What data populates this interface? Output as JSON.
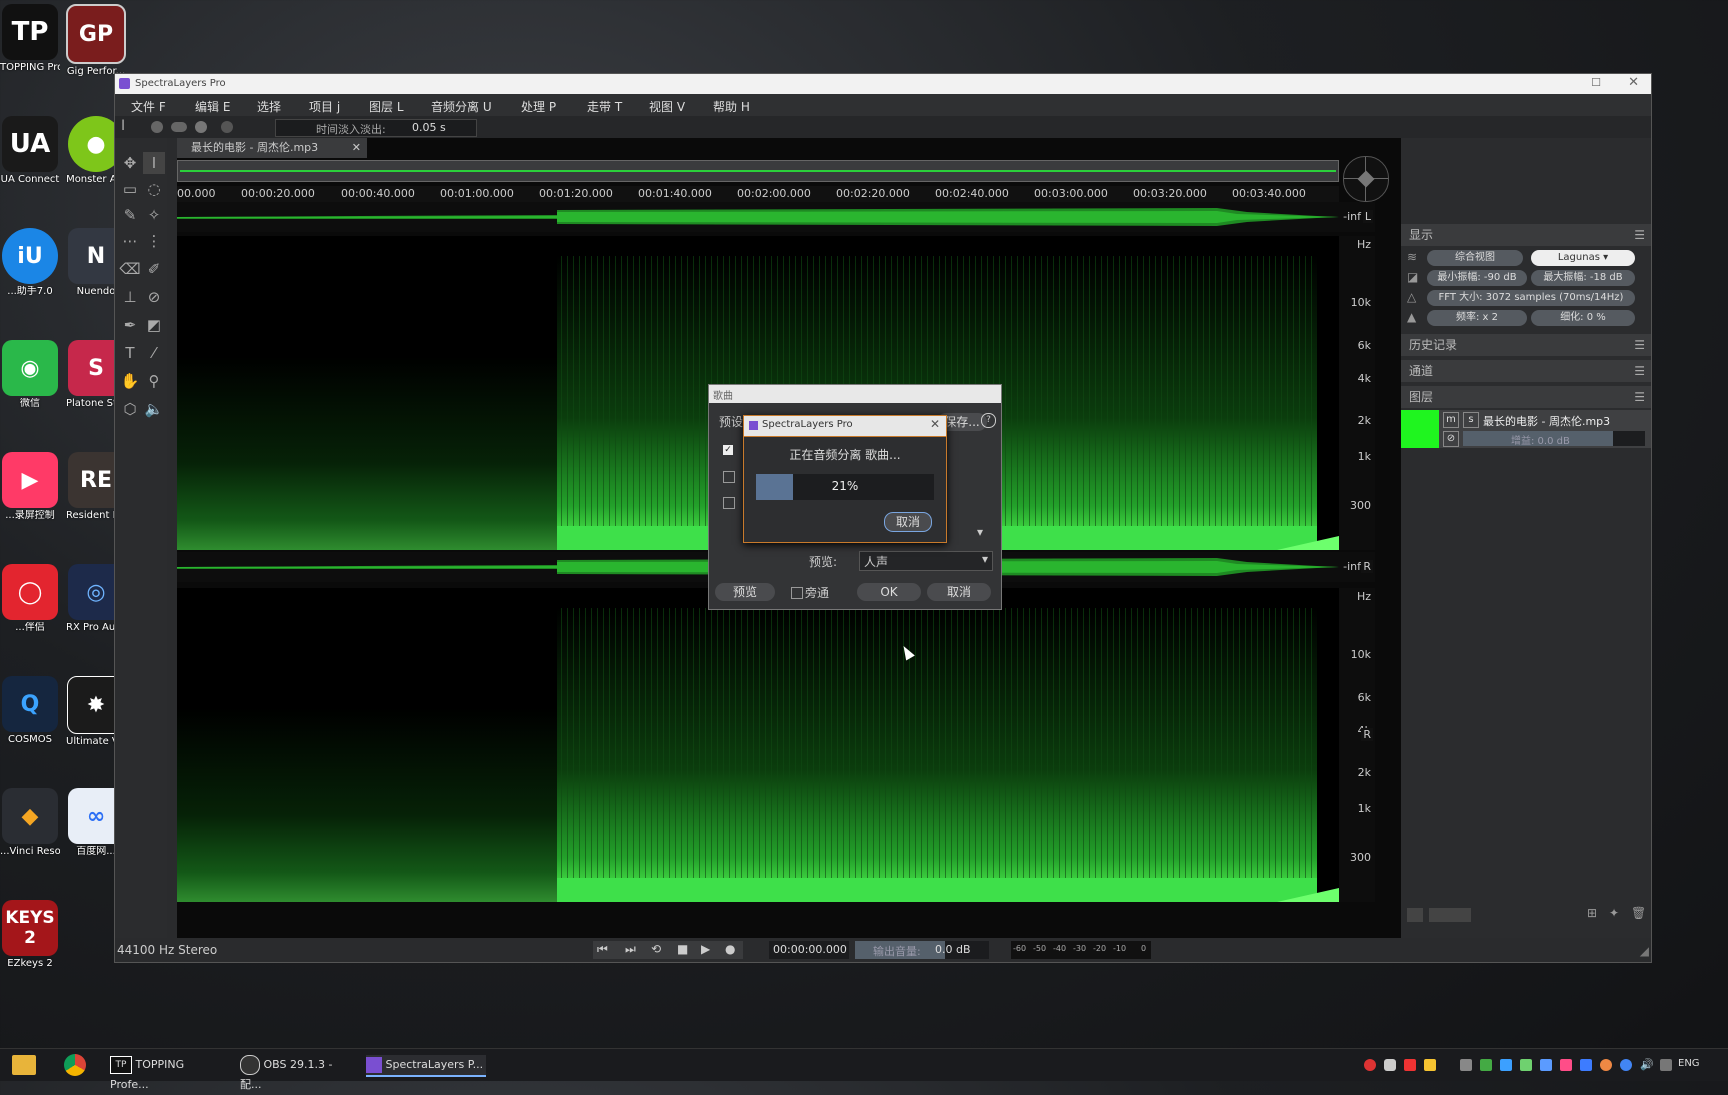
{
  "desktop": {
    "icons": [
      {
        "label": "TOPPING\nProfessional ...",
        "glyph": "TP",
        "color": "#111111"
      },
      {
        "label": "Gig Perfor...",
        "glyph": "GP",
        "color": "#7a1d1d"
      },
      {
        "label": "UA Connect",
        "glyph": "UA",
        "color": "#1a1a1a"
      },
      {
        "label": "Monster A...",
        "glyph": "•",
        "color": "#7ec61a"
      },
      {
        "label": "...助手7.0",
        "glyph": "iU",
        "color": "#1b86e6"
      },
      {
        "label": "Nuendo",
        "glyph": "N",
        "color": "#333842"
      },
      {
        "label": "微信",
        "glyph": "◉",
        "color": "#2ab84a"
      },
      {
        "label": "Platone St... Straight",
        "glyph": "S",
        "color": "#c6284b"
      },
      {
        "label": "...录屏控制",
        "glyph": "▶",
        "color": "#ff3a67"
      },
      {
        "label": "Resident E...",
        "glyph": "RE",
        "color": "#3b3431"
      },
      {
        "label": "...伴侣",
        "glyph": "◯",
        "color": "#e3252f"
      },
      {
        "label": "RX Pro Au... Editor",
        "glyph": "◎",
        "color": "#1d2a4a"
      },
      {
        "label": "COSMOS",
        "glyph": "Q",
        "color": "#15263f"
      },
      {
        "label": "Ultimate V... Remov...",
        "glyph": "✸",
        "color": "#1b1b1b"
      },
      {
        "label": "...Vinci Resolve",
        "glyph": "◆",
        "color": "#2a2d33"
      },
      {
        "label": "百度网...",
        "glyph": "∞",
        "color": "#e8eef7"
      },
      {
        "label": "EZkeys 2",
        "glyph": "KEYS 2",
        "color": "#a4161a"
      }
    ]
  },
  "window": {
    "title": "SpectraLayers Pro",
    "menu": [
      "文件 F",
      "编辑 E",
      "选择",
      "项目 j",
      "图层 L",
      "音频分离 U",
      "处理 P",
      "走带 T",
      "视图 V",
      "帮助 H"
    ],
    "toolbar_fade_label": "时间淡入淡出:",
    "toolbar_fade_value": "0.05 s",
    "tab_title": "最长的电影 - 周杰伦.mp3",
    "timeline_ticks": [
      "00.000",
      "00:00:20.000",
      "00:00:40.000",
      "00:01:00.000",
      "00:01:20.000",
      "00:01:40.000",
      "00:02:00.000",
      "00:02:20.000",
      "00:02:40.000",
      "00:03:00.000",
      "00:03:20.000",
      "00:03:40.000"
    ],
    "wave_inf": "-inf",
    "channel_l": "L",
    "channel_r": "R",
    "hz_unit": "Hz",
    "hz_ticks": [
      "10k",
      "6k",
      "4k",
      "2k",
      "1k",
      "300"
    ],
    "status_format": "44100 Hz Stereo",
    "transport_time": "00:00:00.000",
    "output_label": "输出音量:",
    "output_value": "0.0 dB",
    "meter_ticks": [
      "-60",
      "-50",
      "-40",
      "-30",
      "-20",
      "-10",
      "0"
    ]
  },
  "right_panel": {
    "display_header": "显示",
    "mode_button": "综合视图",
    "colormap": "Lagunas",
    "min_level_label": "最小振幅:",
    "min_level_value": "-90 dB",
    "max_level_label": "最大振幅:",
    "max_level_value": "-18 dB",
    "fft_label": "FFT 大小:",
    "fft_value": "3072 samples (70ms/14Hz)",
    "zoom_label": "频率:",
    "zoom_value": "x 2",
    "detail_label": "细化:",
    "detail_value": "0 %",
    "history_header": "历史记录",
    "channels_header": "通道",
    "layers_header": "图层",
    "layer_m": "m",
    "layer_s": "s",
    "layer_name": "最长的电影 - 周杰伦.mp3",
    "layer_gain": "增益: 0.0 dB"
  },
  "dialog_unmix": {
    "title": "歌曲",
    "preset_label": "预设",
    "more_button": "保存...",
    "help_icon": "?",
    "preview_label": "预览:",
    "preview_value": "人声",
    "preview_button": "预览",
    "bypass_label": "旁通",
    "ok_button": "OK",
    "cancel_button": "取消"
  },
  "dialog_progress": {
    "title": "SpectraLayers Pro",
    "message": "正在音频分离 歌曲...",
    "percent_text": "21%",
    "progress": 0.21,
    "cancel_button": "取消"
  },
  "taskbar": {
    "items": [
      "TOPPING Profe...",
      "OBS 29.1.3 - 配...",
      "SpectraLayers P..."
    ],
    "lang": "ENG"
  }
}
